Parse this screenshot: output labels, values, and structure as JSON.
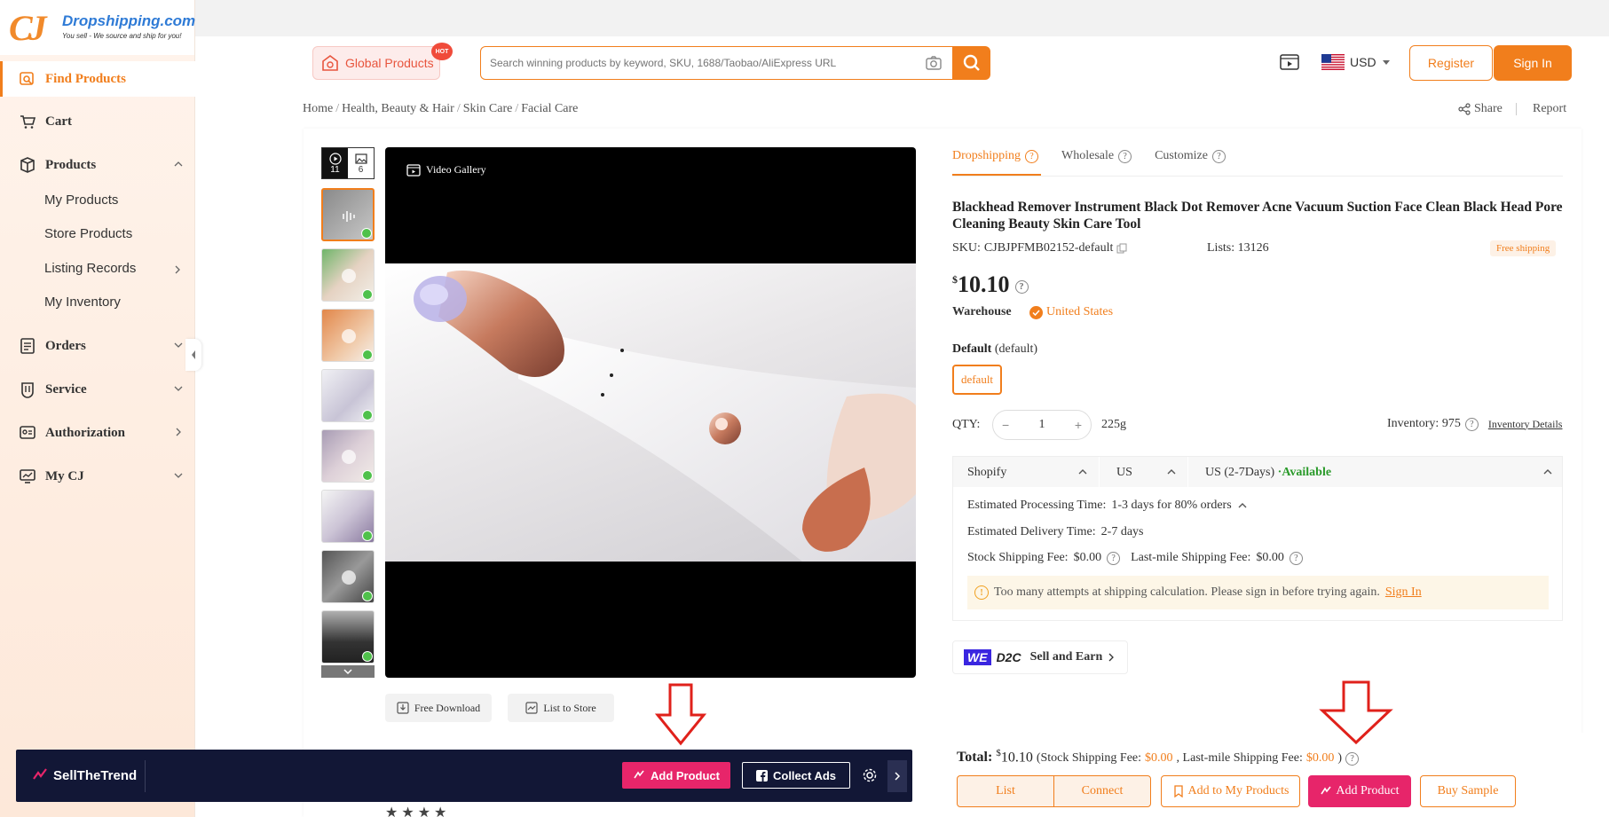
{
  "logo": {
    "mark": "CJ",
    "name": "Dropshipping.com",
    "tagline": "You sell - We source and ship for you!"
  },
  "sidebar": {
    "items": [
      {
        "label": "Find Products",
        "icon": "find-products-icon"
      },
      {
        "label": "Cart",
        "icon": "cart-icon"
      },
      {
        "label": "Products",
        "icon": "products-icon"
      },
      {
        "label": "Orders",
        "icon": "orders-icon"
      },
      {
        "label": "Service",
        "icon": "service-icon"
      },
      {
        "label": "Authorization",
        "icon": "authorization-icon"
      },
      {
        "label": "My CJ",
        "icon": "my-cj-icon"
      }
    ],
    "sub_items": [
      "My Products",
      "Store Products",
      "Listing Records",
      "My Inventory"
    ]
  },
  "header": {
    "global_products": "Global Products",
    "hot": "HOT",
    "search_placeholder": "Search winning products by keyword, SKU, 1688/Taobao/AliExpress URL",
    "currency": "USD",
    "register": "Register",
    "sign_in": "Sign In"
  },
  "breadcrumb": {
    "items": [
      "Home",
      "Health, Beauty & Hair",
      "Skin Care",
      "Facial Care"
    ],
    "share": "Share",
    "report": "Report"
  },
  "gallery": {
    "video_count": "11",
    "image_count": "6",
    "video_label": "Video Gallery",
    "free_download": "Free Download",
    "list_to_store": "List to Store"
  },
  "product": {
    "tabs": [
      "Dropshipping",
      "Wholesale",
      "Customize"
    ],
    "title": "Blackhead Remover Instrument Black Dot Remover Acne Vacuum Suction Face Clean Black Head Pore Cleaning Beauty Skin Care Tool",
    "sku_label": "SKU:",
    "sku": "CJBJPFMB02152-default",
    "lists_label": "Lists:",
    "lists": "13126",
    "free_shipping": "Free shipping",
    "price_symbol": "$",
    "price": "10.10",
    "warehouse_label": "Warehouse",
    "warehouse": "United States",
    "variant_label": "Default",
    "variant_value": "(default)",
    "variant_option": "default",
    "qty_label": "QTY:",
    "qty": "1",
    "weight": "225g",
    "inventory_label": "Inventory: 975",
    "inventory_details": "Inventory Details"
  },
  "shipping": {
    "platform": "Shopify",
    "country": "US",
    "method": "US (2-7Days)",
    "available": "·Available",
    "processing_label": "Estimated Processing Time:",
    "processing": "1-3 days for 80% orders",
    "delivery_label": "Estimated Delivery Time:",
    "delivery": "2-7 days",
    "stock_fee_label": "Stock Shipping Fee:",
    "stock_fee": "$0.00",
    "lastmile_label": "Last-mile Shipping Fee:",
    "lastmile": "$0.00",
    "warning": "Too many attempts at shipping calculation. Please sign in before trying again.",
    "warning_link": "Sign In"
  },
  "d2c": {
    "we": "WE",
    "d2c": "D2C",
    "label": "Sell and Earn"
  },
  "bottom": {
    "total_label": "Total:",
    "total_symbol": "$",
    "total": "10.10",
    "breakdown_open": "(Stock Shipping Fee:",
    "stock_fee": "$0.00",
    "breakdown_mid": ", Last-mile Shipping Fee:",
    "lastmile_fee": "$0.00",
    "breakdown_close": ")",
    "list": "List",
    "connect": "Connect",
    "add_to_my_products": "Add to My Products",
    "add_product": "Add Product",
    "buy_sample": "Buy Sample"
  },
  "sellthetrend": {
    "logo": "SellTheTrend",
    "add_product": "Add Product",
    "collect_ads": "Collect Ads"
  },
  "colors": {
    "accent": "#f17e1c",
    "pink": "#e7256a",
    "navy": "#121736",
    "annotation": "#e0211b"
  }
}
